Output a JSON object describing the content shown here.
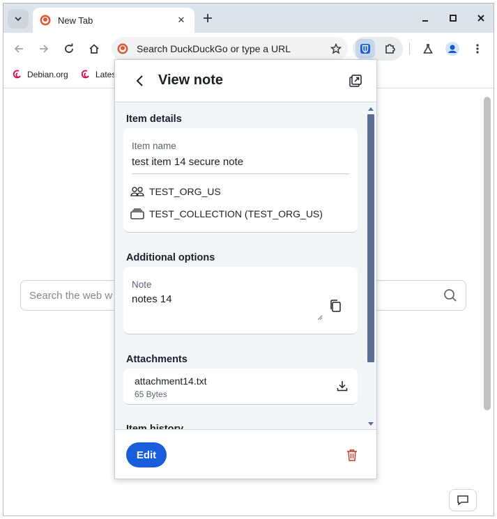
{
  "browser": {
    "tab_title": "New Tab",
    "omnibox_placeholder": "Search DuckDuckGo or type a URL",
    "bookmarks": [
      {
        "label": "Debian.org"
      },
      {
        "label": "Lates"
      }
    ]
  },
  "page": {
    "search_placeholder": "Search the web w"
  },
  "popup": {
    "title": "View note",
    "item_details": {
      "section_title": "Item details",
      "item_name_label": "Item name",
      "item_name_value": "test item 14 secure note",
      "organization": "TEST_ORG_US",
      "collection": "TEST_COLLECTION (TEST_ORG_US)"
    },
    "additional_options": {
      "section_title": "Additional options",
      "note_label": "Note",
      "note_value": "notes 14"
    },
    "attachments": {
      "section_title": "Attachments",
      "file_name": "attachment14.txt",
      "file_size": "65 Bytes"
    },
    "item_history": {
      "section_title": "Item history"
    },
    "edit_label": "Edit"
  },
  "colors": {
    "primary": "#175ddc",
    "danger": "#c83522",
    "scrollbar": "#5b6f94"
  }
}
